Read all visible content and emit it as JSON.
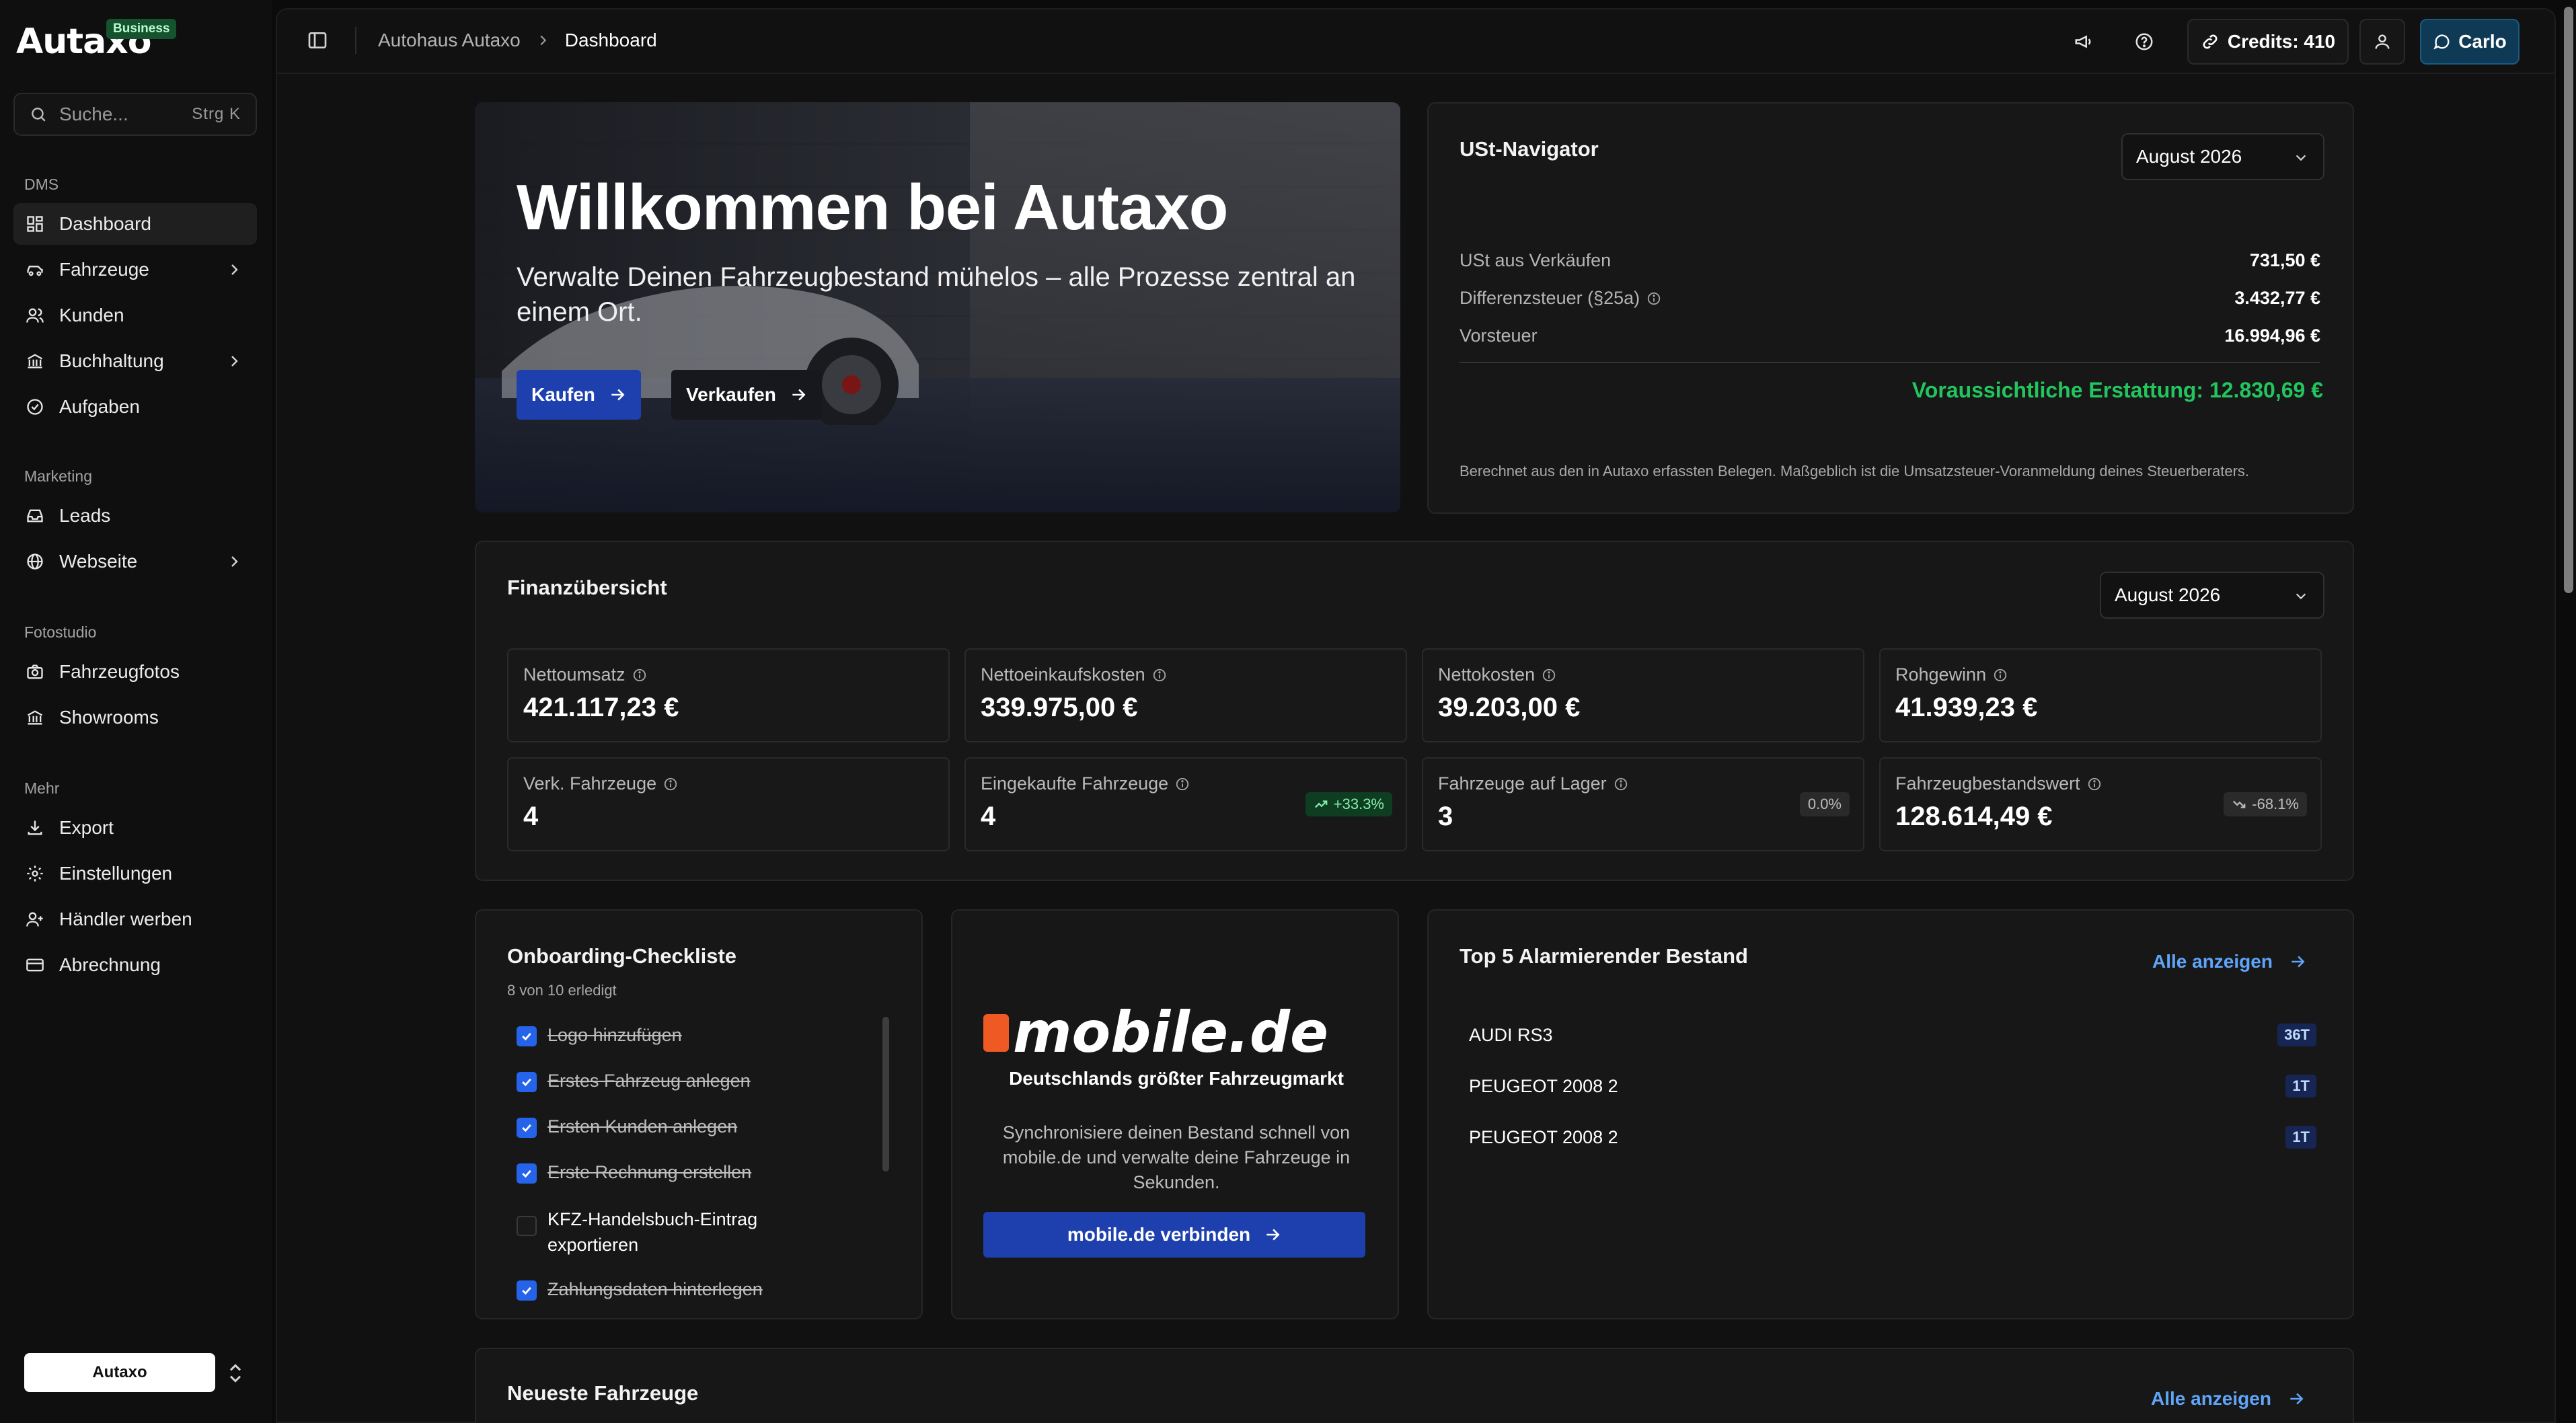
{
  "brand": {
    "name": "Autaxo",
    "tier": "Business"
  },
  "search": {
    "placeholder": "Suche...",
    "shortcut": "Strg  K"
  },
  "sidebar": {
    "groups": [
      {
        "title": "DMS",
        "items": [
          {
            "label": "Dashboard",
            "icon": "dashboard-icon",
            "active": true
          },
          {
            "label": "Fahrzeuge",
            "icon": "car-icon",
            "expandable": true
          },
          {
            "label": "Kunden",
            "icon": "users-icon"
          },
          {
            "label": "Buchhaltung",
            "icon": "bank-icon",
            "expandable": true
          },
          {
            "label": "Aufgaben",
            "icon": "check-circle-icon"
          }
        ]
      },
      {
        "title": "Marketing",
        "items": [
          {
            "label": "Leads",
            "icon": "inbox-icon"
          },
          {
            "label": "Webseite",
            "icon": "globe-icon",
            "expandable": true
          }
        ]
      },
      {
        "title": "Fotostudio",
        "items": [
          {
            "label": "Fahrzeugfotos",
            "icon": "camera-icon"
          },
          {
            "label": "Showrooms",
            "icon": "building-icon"
          }
        ]
      },
      {
        "title": "Mehr",
        "items": [
          {
            "label": "Export",
            "icon": "download-icon"
          },
          {
            "label": "Einstellungen",
            "icon": "gear-icon"
          },
          {
            "label": "Händler werben",
            "icon": "user-plus-icon"
          },
          {
            "label": "Abrechnung",
            "icon": "credit-card-icon"
          }
        ]
      }
    ],
    "workspace": "Autaxo"
  },
  "topbar": {
    "breadcrumb": [
      "Autohaus Autaxo",
      "Dashboard"
    ],
    "credits_label": "Credits: 410",
    "user_label": "Carlo"
  },
  "hero": {
    "title": "Willkommen bei Autaxo",
    "subtitle": "Verwalte Deinen Fahrzeugbestand mühelos – alle Prozesse zentral an einem Ort.",
    "buy_label": "Kaufen",
    "sell_label": "Verkaufen"
  },
  "ust": {
    "title": "USt-Navigator",
    "period": "August 2026",
    "rows": [
      {
        "label": "USt aus Verkäufen",
        "value": "731,50 €",
        "info": false
      },
      {
        "label": "Differenzsteuer (§25a)",
        "value": "3.432,77 €",
        "info": true
      },
      {
        "label": "Vorsteuer",
        "value": "16.994,96 €",
        "info": false
      }
    ],
    "total": "Voraussichtliche Erstattung: 12.830,69 €",
    "note": "Berechnet aus den in Autaxo erfassten Belegen. Maßgeblich ist die Umsatzsteuer-Voranmeldung deines Steuerberaters.",
    "total_color": "#22c55e"
  },
  "finance": {
    "title": "Finanzübersicht",
    "period": "August 2026",
    "kpis": [
      {
        "label": "Nettoumsatz",
        "value": "421.117,23 €"
      },
      {
        "label": "Nettoeinkaufskosten",
        "value": "339.975,00 €"
      },
      {
        "label": "Nettokosten",
        "value": "39.203,00 €"
      },
      {
        "label": "Rohgewinn",
        "value": "41.939,23 €"
      },
      {
        "label": "Verk. Fahrzeuge",
        "value": "4"
      },
      {
        "label": "Eingekaufte Fahrzeuge",
        "value": "4",
        "badge": "+33.3%",
        "trend": "up"
      },
      {
        "label": "Fahrzeuge auf Lager",
        "value": "3",
        "badge": "0.0%",
        "trend": "flat"
      },
      {
        "label": "Fahrzeugbestandswert",
        "value": "128.614,49 €",
        "badge": "-68.1%",
        "trend": "down"
      }
    ]
  },
  "checklist": {
    "title": "Onboarding-Checkliste",
    "progress": "8 von 10 erledigt",
    "items": [
      {
        "label": "Logo hinzufügen",
        "done": true
      },
      {
        "label": "Erstes Fahrzeug anlegen",
        "done": true
      },
      {
        "label": "Ersten Kunden anlegen",
        "done": true
      },
      {
        "label": "Erste Rechnung erstellen",
        "done": true
      },
      {
        "label": "KFZ-Handelsbuch-Eintrag exportieren",
        "done": false
      },
      {
        "label": "Zahlungsdaten hinterlegen",
        "done": true
      }
    ]
  },
  "mobile": {
    "logo": "mobile.de",
    "tagline": "Deutschlands größter Fahrzeugmarkt",
    "description": "Synchronisiere deinen Bestand schnell von mobile.de und verwalte deine Fahrzeuge in Sekunden.",
    "button": "mobile.de verbinden",
    "accent": "#ef5a24"
  },
  "top5": {
    "title": "Top 5 Alarmierender Bestand",
    "link": "Alle anzeigen",
    "rows": [
      {
        "name": "AUDI RS3",
        "days": "36T"
      },
      {
        "name": "PEUGEOT 2008 2",
        "days": "1T"
      },
      {
        "name": "PEUGEOT 2008 2",
        "days": "1T"
      }
    ]
  },
  "newest": {
    "title": "Neueste Fahrzeuge",
    "link": "Alle anzeigen"
  },
  "colors": {
    "primary": "#1e40af",
    "link": "#60a5fa",
    "success": "#22c55e",
    "background": "#111111"
  }
}
